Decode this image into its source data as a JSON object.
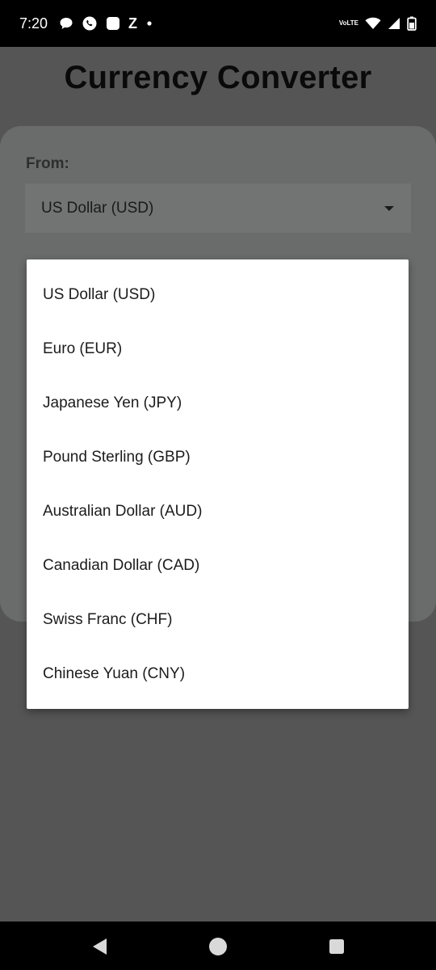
{
  "status_bar": {
    "time": "7:20",
    "left_icons": [
      "chat-bubble-icon",
      "whatsapp-icon",
      "app-square-icon",
      "z-app-icon",
      "dot-icon"
    ],
    "z_label": "Z",
    "volte_top": "Vo",
    "volte_bottom": "LTE",
    "right_icons": [
      "volte-icon",
      "wifi-icon",
      "signal-icon",
      "battery-icon"
    ]
  },
  "app": {
    "title": "Currency Converter",
    "from_label": "From:",
    "from_selected": "US Dollar (USD)"
  },
  "dropdown": {
    "options": [
      "US Dollar (USD)",
      "Euro (EUR)",
      "Japanese Yen (JPY)",
      "Pound Sterling (GBP)",
      "Australian Dollar (AUD)",
      "Canadian Dollar (CAD)",
      "Swiss Franc (CHF)",
      "Chinese Yuan (CNY)"
    ]
  },
  "nav_bar": {
    "icons": [
      "back-icon",
      "home-icon",
      "recents-icon"
    ]
  },
  "colors": {
    "scrim_background": "#555555",
    "card": "#6a6b6b",
    "menu_background": "#ffffff",
    "system_bars": "#000000"
  }
}
